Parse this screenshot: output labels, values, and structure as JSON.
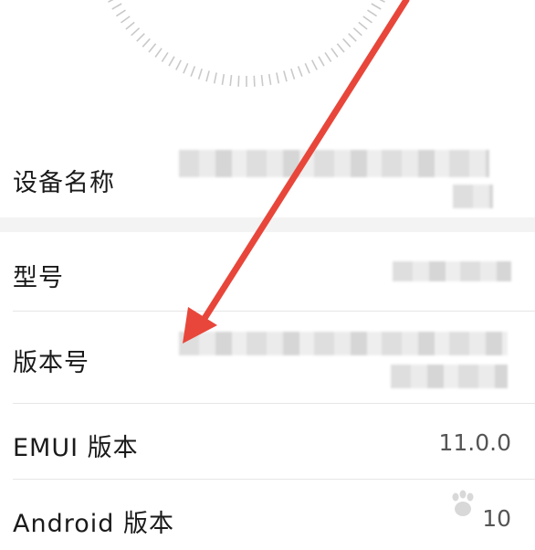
{
  "device_info": {
    "rows": [
      {
        "label": "设备名称",
        "value": ""
      },
      {
        "label": "型号",
        "value": ""
      },
      {
        "label": "版本号",
        "value": ""
      },
      {
        "label": "EMUI 版本",
        "value": "11.0.0"
      },
      {
        "label": "Android 版本",
        "value": "10"
      }
    ]
  },
  "annotation": {
    "arrow_color": "#e8463a"
  },
  "watermark": {
    "logo_icon": "baidu-paw-icon"
  }
}
